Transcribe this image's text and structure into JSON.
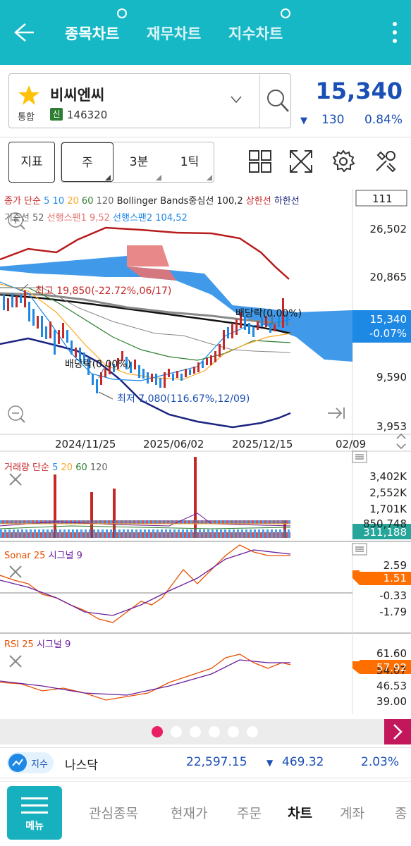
{
  "header": {
    "tabs": [
      {
        "label": "종목차트",
        "active": true
      },
      {
        "label": "재무차트",
        "active": false
      },
      {
        "label": "지수차트",
        "active": false
      }
    ]
  },
  "stock": {
    "name": "비씨엔씨",
    "market": "통합",
    "credit_badge": "신",
    "code": "146320",
    "price": "15,340",
    "change": "130",
    "change_pct": "0.84%",
    "color_down": "#1a4fb5"
  },
  "toolbar": {
    "indicator_label": "지표",
    "periods": [
      "주",
      "3분",
      "1틱"
    ],
    "selected_period": "주"
  },
  "chart": {
    "legend_line1": {
      "parts": [
        {
          "text": "종가 단순",
          "color": "#c62828"
        },
        {
          "text": "5",
          "color": "#1e88e5"
        },
        {
          "text": "10",
          "color": "#1e88e5"
        },
        {
          "text": "20",
          "color": "#f9a825"
        },
        {
          "text": "60",
          "color": "#2e7d32"
        },
        {
          "text": "120",
          "color": "#666666"
        },
        {
          "text": "Bollinger Bands중심선 100,2",
          "color": "#222222"
        },
        {
          "text": "상한선",
          "color": "#c62828"
        },
        {
          "text": "하한선",
          "color": "#1a237e"
        }
      ]
    },
    "legend_line2": {
      "parts": [
        {
          "text": "기준선 52",
          "color": "#666666"
        },
        {
          "text": "선행스팬1 9,52",
          "color": "#e57373"
        },
        {
          "text": "선행스팬2 104,52",
          "color": "#1e88e5"
        }
      ]
    },
    "count_box": "111",
    "y_axis": [
      "26,502",
      "20,865",
      "9,590",
      "3,953"
    ],
    "current_price_tag": "15,340",
    "current_pct_tag": "-0.07%",
    "annotations": {
      "high": "최고 19,850(-22.72%,06/17)",
      "low": "최저 7,080(116.67%,12/09)",
      "dividend1": "배당락(0.00%)",
      "dividend2": "배당락(0.00%)"
    },
    "x_axis": [
      "2024/11/25",
      "2025/06/02",
      "2025/12/15",
      "02/09"
    ]
  },
  "volume": {
    "legend": [
      {
        "text": "거래량 단순",
        "color": "#c62828"
      },
      {
        "text": "5",
        "color": "#1e88e5"
      },
      {
        "text": "20",
        "color": "#f9a825"
      },
      {
        "text": "60",
        "color": "#2e7d32"
      },
      {
        "text": "120",
        "color": "#666666"
      }
    ],
    "y_axis": [
      "3,402K",
      "2,552K",
      "1,701K",
      "850,748"
    ],
    "current_tag": "311,188"
  },
  "sonar": {
    "legend": [
      {
        "text": "Sonar 25",
        "color": "#e65100"
      },
      {
        "text": "시그널 9",
        "color": "#6a1b9a"
      }
    ],
    "y_axis": [
      "2.59",
      "-0.33",
      "-1.79"
    ],
    "current_tag": "1.51"
  },
  "rsi": {
    "legend": [
      {
        "text": "RSI 25",
        "color": "#e65100"
      },
      {
        "text": "시그널 9",
        "color": "#6a1b9a"
      }
    ],
    "y_axis": [
      "61.60",
      "54.07",
      "46.53",
      "39.00"
    ],
    "current_tag": "57.92"
  },
  "index_bar": {
    "badge": "지수",
    "name": "나스닥",
    "value": "22,597.15",
    "change": "469.32",
    "change_pct": "2.03%"
  },
  "bottom_nav": {
    "menu_label": "메뉴",
    "items": [
      "관심종목",
      "현재가",
      "주문",
      "차트",
      "계좌",
      "종"
    ],
    "active": "차트"
  }
}
